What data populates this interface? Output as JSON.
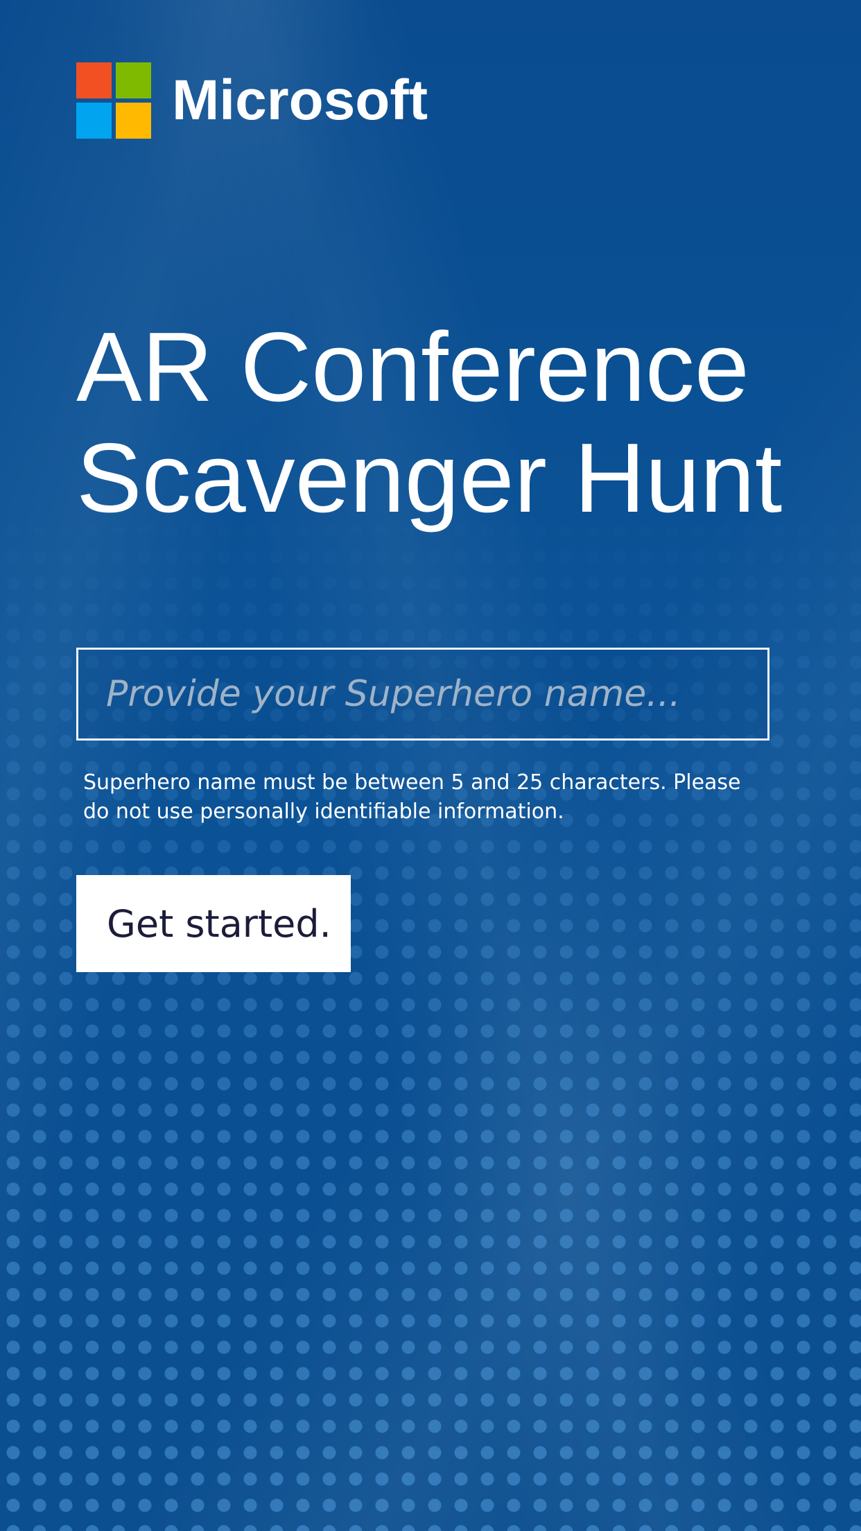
{
  "brand": {
    "name": "Microsoft",
    "logo_colors": [
      "#f25022",
      "#7fba00",
      "#00a4ef",
      "#ffb900"
    ]
  },
  "title": {
    "line1": "AR Conference",
    "line2": "Scavenger Hunt"
  },
  "name_field": {
    "placeholder": "Provide your Superhero name...",
    "value": ""
  },
  "hint": "Superhero name must be between 5 and 25 characters. Please do not use personally identifiable information.",
  "start_button": {
    "label": "Get started."
  },
  "colors": {
    "background": "#0a4f92",
    "button_bg": "#ffffff",
    "button_text": "#1c1c3a"
  }
}
